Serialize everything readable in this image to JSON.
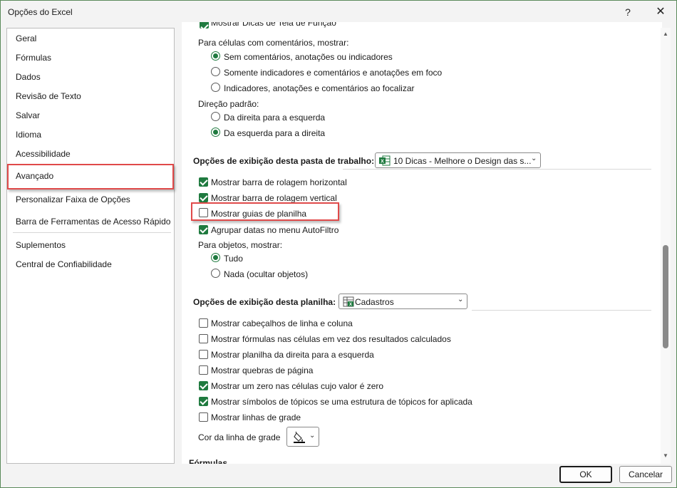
{
  "window": {
    "title": "Opções do Excel",
    "help": "?",
    "close": "✕"
  },
  "sidebar": {
    "items": [
      {
        "label": "Geral"
      },
      {
        "label": "Fórmulas"
      },
      {
        "label": "Dados"
      },
      {
        "label": "Revisão de Texto"
      },
      {
        "label": "Salvar"
      },
      {
        "label": "Idioma"
      },
      {
        "label": "Acessibilidade"
      },
      {
        "label": "Avançado",
        "selected": true
      },
      {
        "label": "Personalizar Faixa de Opções"
      },
      {
        "label": "Barra de Ferramentas de Acesso Rápido"
      },
      {
        "label": "Suplementos"
      },
      {
        "label": "Central de Confiabilidade"
      }
    ]
  },
  "content": {
    "cut_top_label": "Mostrar Dicas de Tela de Função",
    "comments": {
      "label": "Para células com comentários, mostrar:",
      "options": [
        {
          "label": "Sem comentários, anotações ou indicadores",
          "selected": true
        },
        {
          "label": "Somente indicadores e comentários e anotações em foco",
          "selected": false
        },
        {
          "label": "Indicadores, anotações e comentários ao focalizar",
          "selected": false
        }
      ]
    },
    "direction": {
      "label": "Direção padrão:",
      "options": [
        {
          "label": "Da direita para a esquerda",
          "selected": false
        },
        {
          "label": "Da esquerda para a direita",
          "selected": true
        }
      ]
    },
    "workbook_section": {
      "title": "Opções de exibição desta pasta de trabalho:",
      "combo_value": "10 Dicas - Melhore o Design das s...",
      "checkboxes": [
        {
          "label": "Mostrar barra de rolagem horizontal",
          "checked": true
        },
        {
          "label": "Mostrar barra de rolagem vertical",
          "checked": true
        },
        {
          "label": "Mostrar guias de planilha",
          "checked": false
        },
        {
          "label": "Agrupar datas no menu AutoFiltro",
          "checked": true
        }
      ],
      "objects_label": "Para objetos, mostrar:",
      "objects_options": [
        {
          "label": "Tudo",
          "selected": true
        },
        {
          "label": "Nada (ocultar objetos)",
          "selected": false
        }
      ]
    },
    "sheet_section": {
      "title": "Opções de exibição desta planilha:",
      "combo_value": "Cadastros",
      "checkboxes": [
        {
          "label": "Mostrar cabeçalhos de linha e coluna",
          "checked": false
        },
        {
          "label": "Mostrar fórmulas nas células em vez dos resultados calculados",
          "checked": false
        },
        {
          "label": "Mostrar planilha da direita para a esquerda",
          "checked": false
        },
        {
          "label": "Mostrar quebras de página",
          "checked": false
        },
        {
          "label": "Mostrar um zero nas células cujo valor é zero",
          "checked": true
        },
        {
          "label": "Mostrar símbolos de tópicos se uma estrutura de tópicos for aplicada",
          "checked": true
        },
        {
          "label": "Mostrar linhas de grade",
          "checked": false
        }
      ],
      "grid_color_label": "Cor da linha de grade"
    },
    "cut_bottom_label": "Fórmulas"
  },
  "footer": {
    "ok_label": "OK",
    "cancel_label": "Cancelar"
  },
  "colors": {
    "check_green": "#1f7a3f",
    "highlight_red": "#e04a4a"
  },
  "icons": {
    "workbook_combo": "excel-workbook-icon",
    "sheet_combo": "excel-sheet-icon",
    "grid_color": "paint-bucket-icon"
  }
}
